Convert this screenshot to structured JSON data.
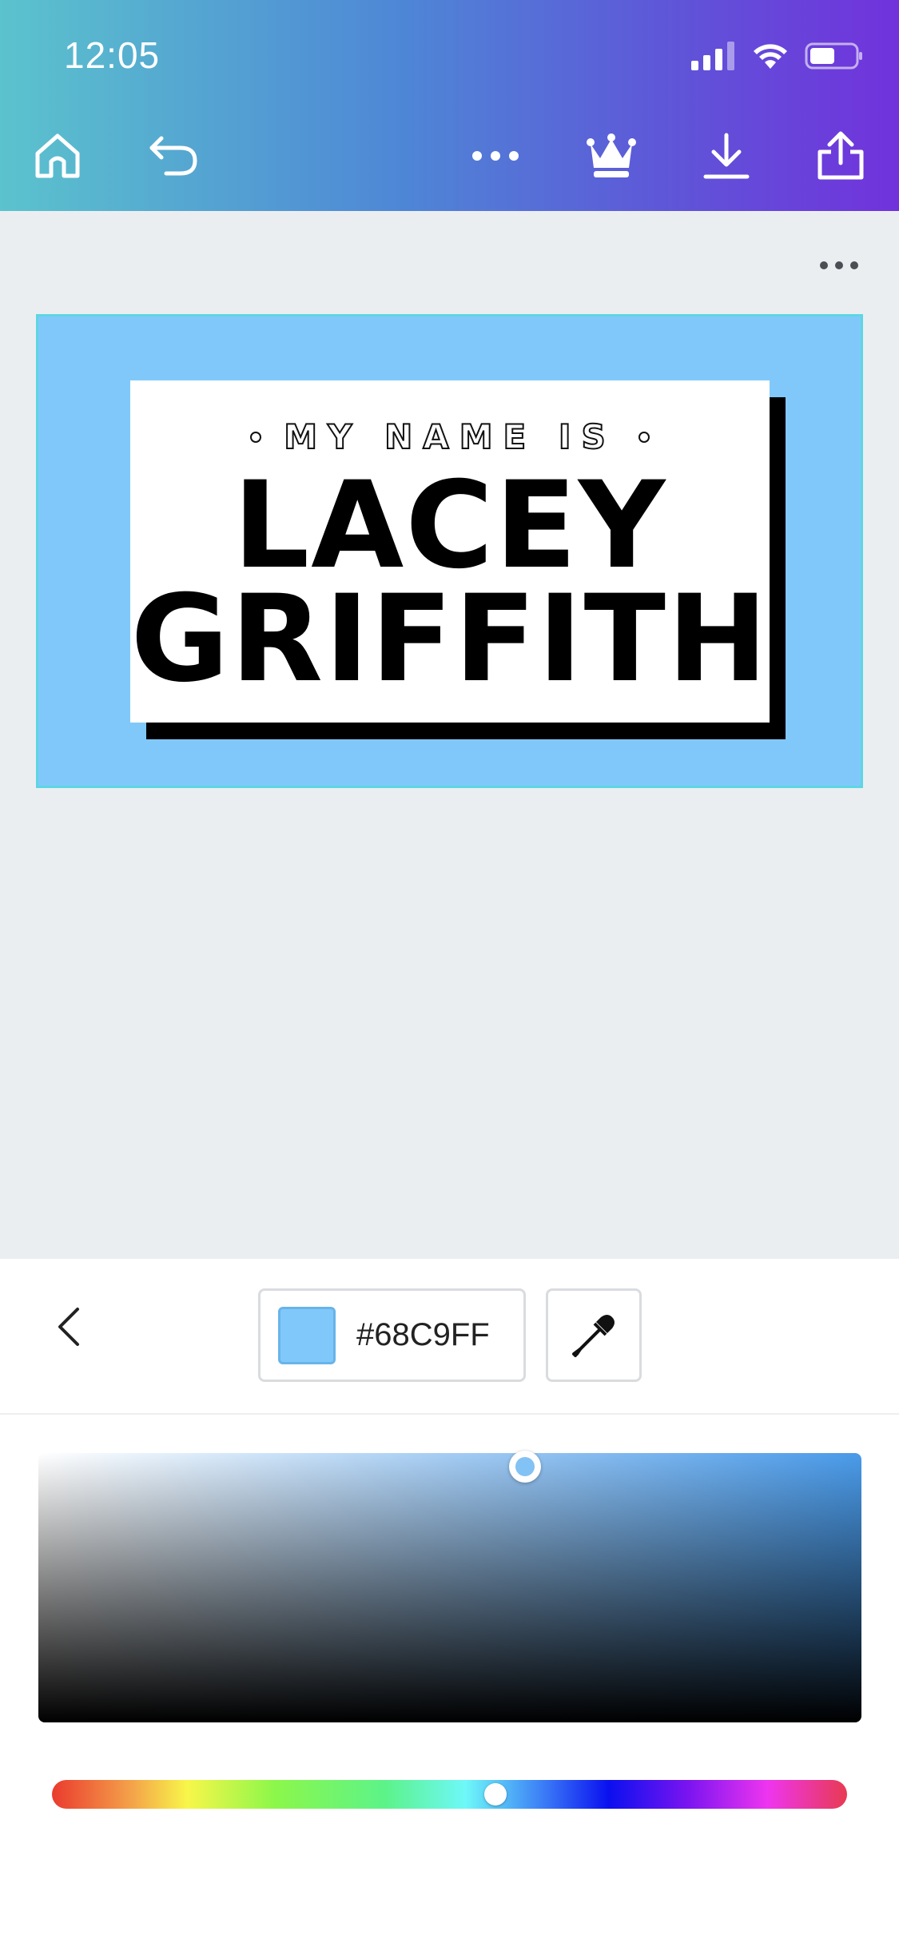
{
  "status_bar": {
    "time": "12:05"
  },
  "toolbar": {
    "icons": [
      "home-icon",
      "undo-icon",
      "more-icon",
      "crown-icon",
      "download-icon",
      "share-icon"
    ]
  },
  "design": {
    "subtitle": "MY NAME IS",
    "first_name": "LACEY",
    "last_name": "GRIFFITH",
    "background_color": "#81C8FA"
  },
  "color_panel": {
    "hex_value": "#68C9FF",
    "swatch_color": "#81C8FA",
    "hue_position": 0.55
  }
}
